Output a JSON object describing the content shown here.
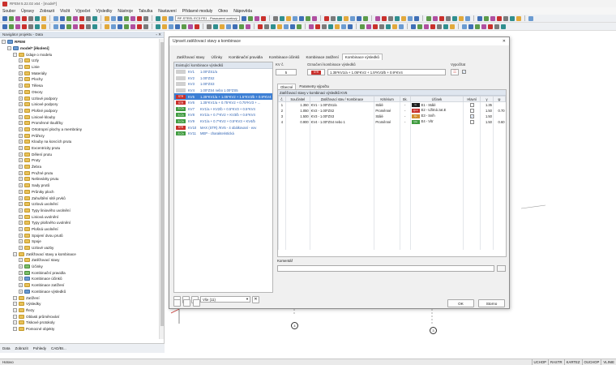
{
  "app": {
    "title": "RFEM 5.22.02 x64 - [model*]"
  },
  "menu": [
    "Soubor",
    "Úpravy",
    "Zobrazit",
    "Vložit",
    "Výpočet",
    "Výsledky",
    "Nástroje",
    "Tabulka",
    "Nastavení",
    "Přídavné moduly",
    "Okno",
    "Nápověda"
  ],
  "toolbar": {
    "module_combo": "RF-STEEL EC3 FE1 - Posouzení ocelový"
  },
  "navigator": {
    "title": "Navigátor projektu - Data",
    "pin": "▫ ✕",
    "items": [
      {
        "label": "RFEM",
        "level": 0,
        "type": "root"
      },
      {
        "label": "model* [ěkolení]",
        "level": 1,
        "type": "blue"
      },
      {
        "label": "Údaje o modelu",
        "level": 2,
        "type": "folder"
      },
      {
        "label": "Uzly",
        "level": 3,
        "type": "folder"
      },
      {
        "label": "Linie",
        "level": 3,
        "type": "folder"
      },
      {
        "label": "Materiály",
        "level": 3,
        "type": "folder"
      },
      {
        "label": "Plochy",
        "level": 3,
        "type": "folder"
      },
      {
        "label": "Tělesa",
        "level": 3,
        "type": "folder"
      },
      {
        "label": "Otvory",
        "level": 3,
        "type": "folder"
      },
      {
        "label": "Uzlové podpory",
        "level": 3,
        "type": "folder"
      },
      {
        "label": "Liniové podpory",
        "level": 3,
        "type": "folder"
      },
      {
        "label": "Plošné podpory",
        "level": 3,
        "type": "folder"
      },
      {
        "label": "Liniové klouby",
        "level": 3,
        "type": "folder"
      },
      {
        "label": "Proměnné tloušťky",
        "level": 3,
        "type": "folder"
      },
      {
        "label": "Ortotropní plochy a membrány",
        "level": 3,
        "type": "folder"
      },
      {
        "label": "Průřezy",
        "level": 3,
        "type": "folder"
      },
      {
        "label": "Klouby na koncích prutu",
        "level": 3,
        "type": "folder"
      },
      {
        "label": "Excentricity prutu",
        "level": 3,
        "type": "folder"
      },
      {
        "label": "Dělení prutu",
        "level": 3,
        "type": "folder"
      },
      {
        "label": "Pruty",
        "level": 3,
        "type": "folder"
      },
      {
        "label": "Žebra",
        "level": 3,
        "type": "folder"
      },
      {
        "label": "Pružné prutu",
        "level": 3,
        "type": "folder"
      },
      {
        "label": "Nelineárity prutu",
        "level": 3,
        "type": "folder"
      },
      {
        "label": "Sady prutů",
        "level": 3,
        "type": "folder"
      },
      {
        "label": "Průniky ploch",
        "level": 3,
        "type": "folder"
      },
      {
        "label": "Zahuštění sítě prvků",
        "level": 3,
        "type": "folder"
      },
      {
        "label": "Uzlová uvolnění",
        "level": 3,
        "type": "folder"
      },
      {
        "label": "Typy liniového uvolnění",
        "level": 3,
        "type": "folder"
      },
      {
        "label": "Liniová uvolnění",
        "level": 3,
        "type": "folder"
      },
      {
        "label": "Typy plošného uvolnění",
        "level": 3,
        "type": "folder"
      },
      {
        "label": "Plošná uvolnění",
        "level": 3,
        "type": "folder"
      },
      {
        "label": "Spojení dvou prutů",
        "level": 3,
        "type": "folder"
      },
      {
        "label": "Spoje",
        "level": 3,
        "type": "folder"
      },
      {
        "label": "Uzlové vazby",
        "level": 3,
        "type": "folder"
      },
      {
        "label": "Zatěžovací stavy a kombinace",
        "level": 2,
        "type": "folder"
      },
      {
        "label": "Zatěžovací stavy",
        "level": 3,
        "type": "folder"
      },
      {
        "label": "Účinky",
        "level": 3,
        "type": "green"
      },
      {
        "label": "Kombinační pravidla",
        "level": 3,
        "type": "green"
      },
      {
        "label": "Kombinace účinků",
        "level": 3,
        "type": "blue"
      },
      {
        "label": "Kombinace zatížení",
        "level": 3,
        "type": "folder"
      },
      {
        "label": "Kombinace výsledků",
        "level": 3,
        "type": "blue"
      },
      {
        "label": "Zatížení",
        "level": 2,
        "type": "folder"
      },
      {
        "label": "Výsledky",
        "level": 2,
        "type": "folder"
      },
      {
        "label": "Řezy",
        "level": 2,
        "type": "folder"
      },
      {
        "label": "Oblasti průměrování",
        "level": 2,
        "type": "folder"
      },
      {
        "label": "Tiskové protokoly",
        "level": 2,
        "type": "folder"
      },
      {
        "label": "Pomocné objekty",
        "level": 2,
        "type": "folder"
      }
    ],
    "tabs": [
      "Data",
      "Zobrazit",
      "Pohledy",
      "CAD/BI..."
    ]
  },
  "dialog": {
    "title": "Upravit zatěžovací stavy a kombinace",
    "close": "✕",
    "tabs": [
      "Zatěžovací stavy",
      "Účinky",
      "Kombinační pravidla",
      "Kombinace účinků",
      "Kombinace zatížení",
      "Kombinace výsledků"
    ],
    "active_tab": 5,
    "list_header": "Existující kombinace výsledků",
    "list": [
      {
        "badge": "",
        "badge_color": "#d0d0d0",
        "id": "KV1",
        "text": "1.00*ZS1/a"
      },
      {
        "badge": "",
        "badge_color": "#d0d0d0",
        "id": "KV2",
        "text": "1.00*ZS2"
      },
      {
        "badge": "",
        "badge_color": "#d0d0d0",
        "id": "KV3",
        "text": "1.00*ZS3"
      },
      {
        "badge": "",
        "badge_color": "#d0d0d0",
        "id": "KV4",
        "text": "1.00*ZS4 nebo 1.00*ZS5"
      },
      {
        "badge": "STR",
        "badge_color": "#c9302c",
        "id": "KV5",
        "text": "1.35*KV1/a + 1.05*KV2 + 1.5*KV3/b + 0.9*KV4",
        "selected": true
      },
      {
        "badge": "STR",
        "badge_color": "#c9302c",
        "id": "KV6",
        "text": "1.35*KV1/a + 0.75*KV2 + 0.75*KV3 + ..."
      },
      {
        "badge": "S Ch",
        "badge_color": "#3f9b3f",
        "id": "KV7",
        "text": "KV1/a + KV2/b + 0.5*KV3 + 0.5*KV4"
      },
      {
        "badge": "S Ch",
        "badge_color": "#3f9b3f",
        "id": "KV8",
        "text": "KV1/a + 0.7*KV2 + KV3/b + 0.6*KV4"
      },
      {
        "badge": "S Ch",
        "badge_color": "#3f9b3f",
        "id": "KV9",
        "text": "KV1/a + 0.7*KV2 + 0.5*KV3 + KV4/b"
      },
      {
        "badge": "STR",
        "badge_color": "#c9302c",
        "id": "KV10",
        "text": "MAX (STR) /KV5 - 4 obálkovaní - exv"
      },
      {
        "badge": "S Ch",
        "badge_color": "#3f9b3f",
        "id": "KV11",
        "text": "MEP - charakteristická"
      }
    ],
    "kv_label": "KV č.",
    "kv_value": "5",
    "naming_label": "Označení kombinace výsledků",
    "naming_badge": "STR",
    "naming_value": "1.35*KV1/a + 1.05*KV2 + 1.5*KV3/b + 0.9*KV4",
    "compute_label": "Vypočítat",
    "inner_tabs": [
      "Obecné",
      "Parametry výpočtu"
    ],
    "grid_caption": "Zatěžovací stavy v kombinaci výsledků KV5",
    "columns": [
      "č.",
      "Součinitel",
      "Zatěžovací stav / Kombinace",
      "Kritérium",
      "Sk.",
      "Účinek",
      "Hlavní",
      "γ",
      "ψ"
    ],
    "rows": [
      {
        "n": "1",
        "factor": "1.350",
        "case": "KV1 - 1.00*ZS1/a",
        "crit": "Stálé",
        "grp": "-",
        "eff_badge": "G",
        "eff_color": "#222222",
        "effect": "E1 - Stálé",
        "main": false,
        "gamma": "1.35",
        "psi": ""
      },
      {
        "n": "2",
        "factor": "1.050",
        "case": "KV2 - 1.00*ZS2",
        "crit": "Proměnné",
        "grp": "-",
        "eff_badge": "QI A",
        "eff_color": "#c9302c",
        "effect": "E2 - Užitná zat.E",
        "main": false,
        "gamma": "1.50",
        "psi": "0.70"
      },
      {
        "n": "3",
        "factor": "1.500",
        "case": "KV3 - 1.00*ZS3",
        "crit": "Stálé",
        "grp": "-",
        "eff_badge": "Qs",
        "eff_color": "#d18c2f",
        "effect": "E3 - Sníh",
        "main": true,
        "gamma": "1.50",
        "psi": ""
      },
      {
        "n": "4",
        "factor": "0.900",
        "case": "KV4 - 1.00*ZS4 nebo 1",
        "crit": "Proměnné",
        "grp": "-",
        "eff_badge": "Qw",
        "eff_color": "#3f9b3f",
        "effect": "E4 - Vítr",
        "main": false,
        "gamma": "1.50",
        "psi": "0.60"
      }
    ],
    "comment_label": "Komentář",
    "filter_value": "Vše (11)",
    "ok": "OK",
    "cancel": "Storno"
  },
  "canvas": {
    "labels": [
      "4",
      "3"
    ]
  },
  "status": {
    "left": "Hotovo",
    "buttons": [
      "UCHOP",
      "RASTR",
      "KARTEZ",
      "OUCHOP",
      "VLINIE"
    ]
  }
}
